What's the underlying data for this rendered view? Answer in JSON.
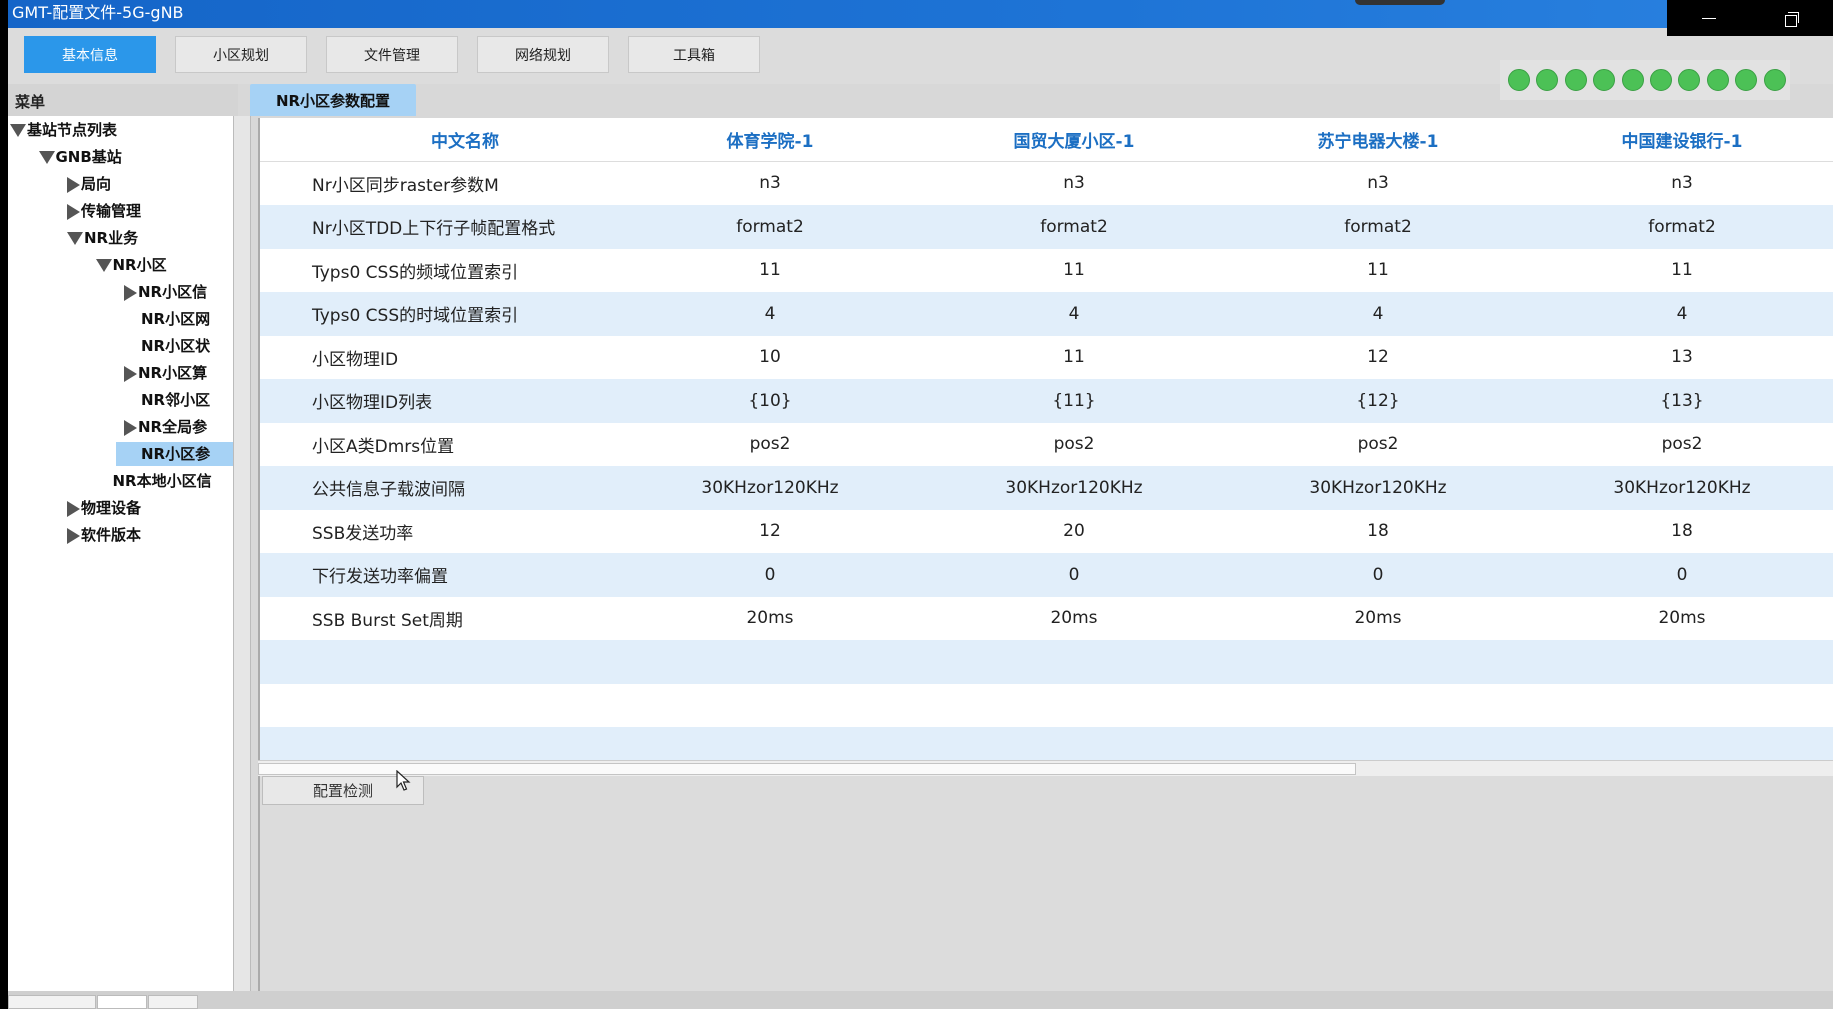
{
  "window": {
    "title": "GMT-配置文件-5G-gNB",
    "controls": {
      "minimize_icon": "minimize-icon",
      "restore_icon": "restore-icon"
    }
  },
  "toolbar": {
    "tabs": [
      {
        "label": "基本信息",
        "active": true
      },
      {
        "label": "小区规划",
        "active": false
      },
      {
        "label": "文件管理",
        "active": false
      },
      {
        "label": "网络规划",
        "active": false
      },
      {
        "label": "工具箱",
        "active": false
      }
    ],
    "status_leds": {
      "count": 10,
      "color": "#4cc156"
    }
  },
  "sidebar": {
    "header": "菜单",
    "tree": [
      {
        "label": "基站节点列表",
        "level": 0,
        "expanded": true,
        "hasChildren": true
      },
      {
        "label": "GNB基站",
        "level": 1,
        "expanded": true,
        "hasChildren": true
      },
      {
        "label": "局向",
        "level": 2,
        "expanded": false,
        "hasChildren": true
      },
      {
        "label": "传输管理",
        "level": 2,
        "expanded": false,
        "hasChildren": true
      },
      {
        "label": "NR业务",
        "level": 2,
        "expanded": true,
        "hasChildren": true
      },
      {
        "label": "NR小区",
        "level": 3,
        "expanded": true,
        "hasChildren": true
      },
      {
        "label": "NR小区信",
        "level": 4,
        "expanded": false,
        "hasChildren": true
      },
      {
        "label": "NR小区网",
        "level": 4,
        "expanded": false,
        "hasChildren": false
      },
      {
        "label": "NR小区状",
        "level": 4,
        "expanded": false,
        "hasChildren": false
      },
      {
        "label": "NR小区算",
        "level": 4,
        "expanded": false,
        "hasChildren": true
      },
      {
        "label": "NR邻小区",
        "level": 4,
        "expanded": false,
        "hasChildren": false
      },
      {
        "label": "NR全局参",
        "level": 4,
        "expanded": false,
        "hasChildren": true
      },
      {
        "label": "NR小区参",
        "level": 4,
        "expanded": false,
        "hasChildren": false,
        "selected": true
      },
      {
        "label": "NR本地小区信",
        "level": 3,
        "expanded": false,
        "hasChildren": false
      },
      {
        "label": "物理设备",
        "level": 2,
        "expanded": false,
        "hasChildren": true
      },
      {
        "label": "软件版本",
        "level": 2,
        "expanded": false,
        "hasChildren": true
      }
    ]
  },
  "content": {
    "tab_label": "NR小区参数配置",
    "table": {
      "headers": [
        "中文名称",
        "体育学院-1",
        "国贸大厦小区-1",
        "苏宁电器大楼-1",
        "中国建设银行-1"
      ],
      "rows": [
        [
          "Nr小区同步raster参数M",
          "n3",
          "n3",
          "n3",
          "n3"
        ],
        [
          "Nr小区TDD上下行子帧配置格式",
          "format2",
          "format2",
          "format2",
          "format2"
        ],
        [
          "Typs0 CSS的频域位置索引",
          "11",
          "11",
          "11",
          "11"
        ],
        [
          "Typs0 CSS的时域位置索引",
          "4",
          "4",
          "4",
          "4"
        ],
        [
          "小区物理ID",
          "10",
          "11",
          "12",
          "13"
        ],
        [
          "小区物理ID列表",
          "{10}",
          "{11}",
          "{12}",
          "{13}"
        ],
        [
          "小区A类Dmrs位置",
          "pos2",
          "pos2",
          "pos2",
          "pos2"
        ],
        [
          "公共信息子载波间隔",
          "30KHzor120KHz",
          "30KHzor120KHz",
          "30KHzor120KHz",
          "30KHzor120KHz"
        ],
        [
          "SSB发送功率",
          "12",
          "20",
          "18",
          "18"
        ],
        [
          "下行发送功率偏置",
          "0",
          "0",
          "0",
          "0"
        ],
        [
          "SSB Burst Set周期",
          "20ms",
          "20ms",
          "20ms",
          "20ms"
        ]
      ],
      "empty_rows": 3
    },
    "check_button": "配置检测"
  },
  "colors": {
    "accent": "#2b97ea",
    "header_text": "#1c6fc3",
    "row_alt": "#e1eefa",
    "selected": "#a6d2f5",
    "titlebar": "#1565c8"
  }
}
